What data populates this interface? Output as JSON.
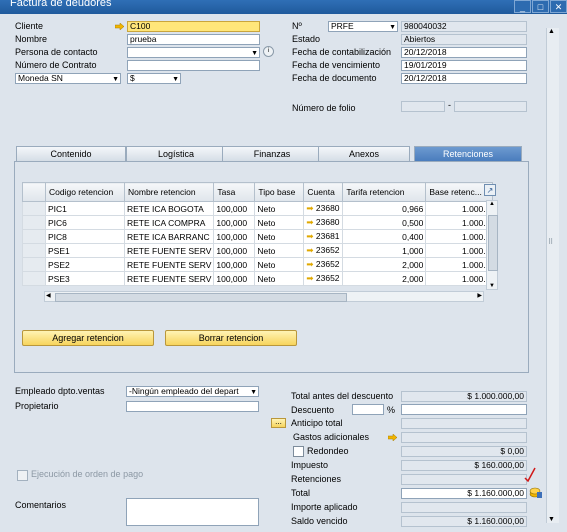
{
  "window": {
    "title": "Factura de deudores"
  },
  "header": {
    "cliente_label": "Cliente",
    "cliente": "C100",
    "nombre_label": "Nombre",
    "nombre": "prueba",
    "persona_label": "Persona de contacto",
    "persona": "",
    "contrato_label": "Número de Contrato",
    "contrato": "",
    "moneda": "Moneda SN",
    "moneda_sym": "$",
    "no_label": "Nº",
    "serie": "PRFE",
    "numero": "980040032",
    "estado_label": "Estado",
    "estado": "Abiertos",
    "fcont_label": "Fecha de contabilización",
    "fcont": "20/12/2018",
    "fvenc_label": "Fecha de vencimiento",
    "fvenc": "19/01/2019",
    "fdoc_label": "Fecha de documento",
    "fdoc": "20/12/2018",
    "folio_label": "Número de folio",
    "folio_sep": "-"
  },
  "tabs": [
    "Contenido",
    "Logística",
    "Finanzas",
    "Anexos",
    "Retenciones"
  ],
  "grid": {
    "columns": [
      "",
      "Codigo retencion",
      "Nombre retencion",
      "Tasa",
      "Tipo base",
      "Cuenta",
      "Tarifa retencion",
      "Base retenc..."
    ],
    "rows": [
      [
        "",
        "PIC1",
        "RETE ICA BOGOTA",
        "100,000",
        "Neto",
        "23680",
        "0,966",
        "1.000.0"
      ],
      [
        "",
        "PIC6",
        "RETE ICA COMPRA",
        "100,000",
        "Neto",
        "23680",
        "0,500",
        "1.000.0"
      ],
      [
        "",
        "PIC8",
        "RETE ICA BARRANC",
        "100,000",
        "Neto",
        "23681",
        "0,400",
        "1.000.0"
      ],
      [
        "",
        "PSE1",
        "RETE FUENTE SERV",
        "100,000",
        "Neto",
        "23652",
        "1,000",
        "1.000.0"
      ],
      [
        "",
        "PSE2",
        "RETE FUENTE SERV",
        "100,000",
        "Neto",
        "23652",
        "2,000",
        "1.000.0"
      ],
      [
        "",
        "PSE3",
        "RETE FUENTE SERV",
        "100,000",
        "Neto",
        "23652",
        "2,000",
        "1.000.0"
      ]
    ]
  },
  "buttons": {
    "agregar": "Agregar retencion",
    "borrar": "Borrar retencion",
    "dots": "..."
  },
  "footer": {
    "empleado_label": "Empleado dpto.ventas",
    "empleado": "-Ningún empleado del depart",
    "propietario_label": "Propietario",
    "orden_label": "Ejecución de orden de pago",
    "comentarios_label": "Comentarios",
    "total_antes_label": "Total antes del descuento",
    "total_antes": "$ 1.000.000,00",
    "descuento_label": "Descuento",
    "pct": "%",
    "anticipo_label": "Anticipo total",
    "gastos_label": "Gastos adicionales",
    "redondeo_label": "Redondeo",
    "redondeo": "$ 0,00",
    "impuesto_label": "Impuesto",
    "impuesto": "$ 160.000,00",
    "retenciones_label": "Retenciones",
    "total_label": "Total",
    "total": "$ 1.160.000,00",
    "importe_label": "Importe aplicado",
    "saldo_label": "Saldo vencido",
    "saldo": "$ 1.160.000,00"
  }
}
